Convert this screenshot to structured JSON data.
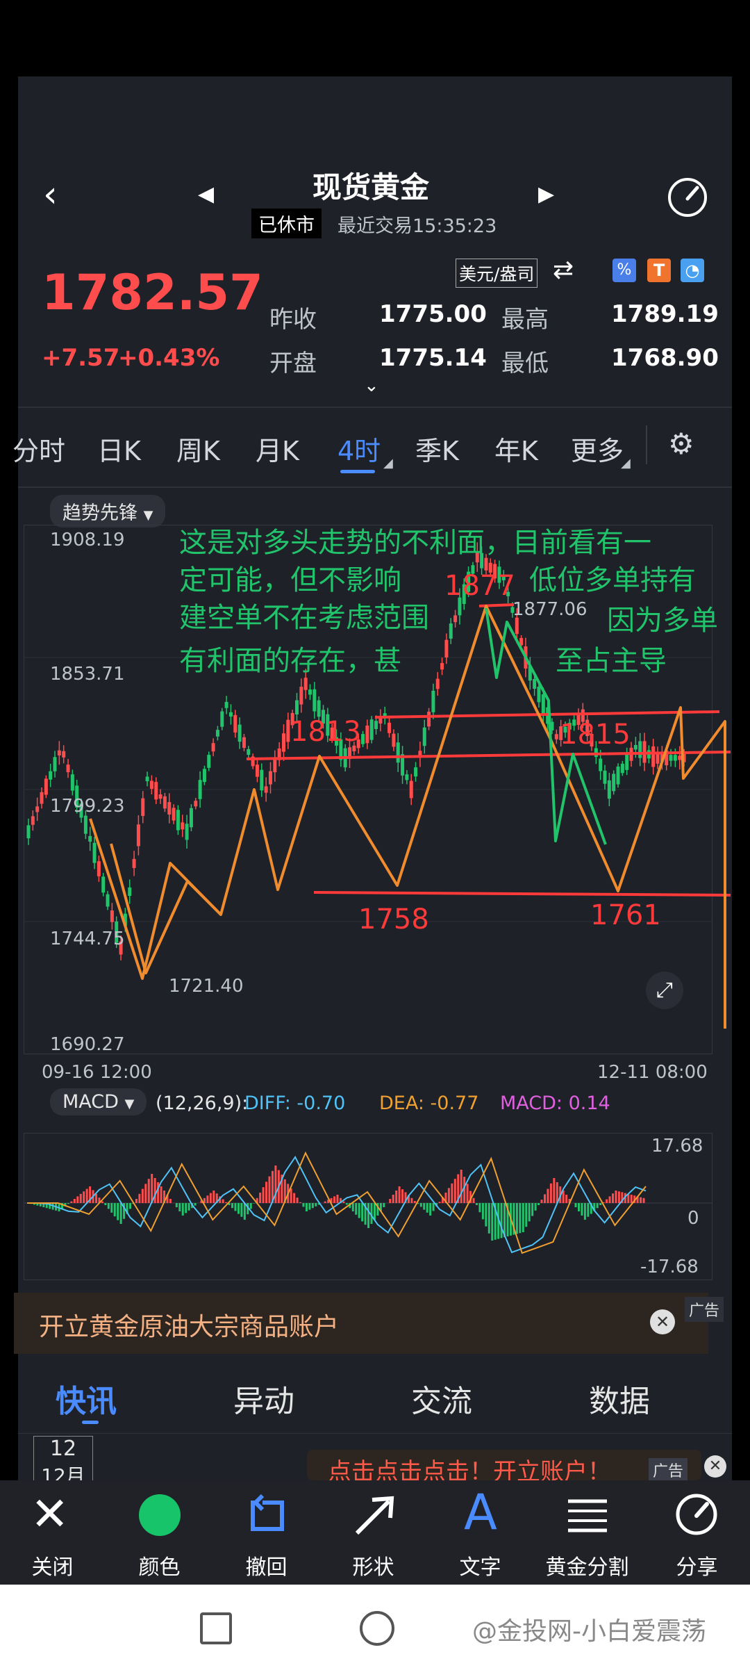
{
  "header": {
    "title": "现货黄金",
    "market_status": "已休市",
    "last_trade": "最近交易15:35:23"
  },
  "quote": {
    "price": "1782.57",
    "change": "+7.57",
    "change_pct": "+0.43%",
    "unit": "美元/盎司",
    "prev_close_label": "昨收",
    "prev_close": "1775.00",
    "high_label": "最高",
    "high": "1789.19",
    "open_label": "开盘",
    "open": "1775.14",
    "low_label": "最低",
    "low": "1768.90"
  },
  "period_tabs": [
    "分时",
    "日K",
    "周K",
    "月K",
    "4时",
    "季K",
    "年K",
    "更多"
  ],
  "active_tab": "4时",
  "indicator": "趋势先锋",
  "price_chart": {
    "y_labels": [
      "1908.19",
      "1853.71",
      "1799.23",
      "1744.75",
      "1690.27"
    ],
    "x_start": "09-16 12:00",
    "x_end": "12-11 08:00",
    "max_label": "1877.06",
    "min_label": "1721.40"
  },
  "macd": {
    "name": "MACD",
    "params": "(12,26,9):",
    "diff": "DIFF: -0.70",
    "dea": "DEA: -0.77",
    "macd": "MACD: 0.14",
    "y_top": "17.68",
    "y_mid": "0",
    "y_bot": "-17.68"
  },
  "annotations": {
    "line1": "这是对多头走势的不利面，目前看有一",
    "line2": "定可能，但不影响",
    "line2b": "低位多单持有",
    "line3": "建空单不在考虑范围",
    "line3b": "因为多单",
    "line4": "有利面的存在，甚",
    "line4b": "至占主导",
    "lvl_1877": "1877",
    "lvl_1813": "1813",
    "lvl_1815": "1815",
    "lvl_1758": "1758",
    "lvl_1761": "1761"
  },
  "ad_bar": {
    "text": "开立黄金原油大宗商品账户",
    "tag": "广告"
  },
  "news_tabs": [
    "快讯",
    "异动",
    "交流",
    "数据"
  ],
  "news_date": {
    "day": "12",
    "month": "12月"
  },
  "ad_banner": {
    "text": "点击点击点击！开立账户！",
    "tag": "广告"
  },
  "toolbar": [
    "关闭",
    "颜色",
    "撤回",
    "形状",
    "文字",
    "黄金分割",
    "分享"
  ],
  "watermark": "@金投网-小白爱震荡",
  "colors": {
    "up": "#ff4d4d",
    "down": "#21c36b",
    "accent": "#4a8cff",
    "annotation": "#f08c2e"
  }
}
